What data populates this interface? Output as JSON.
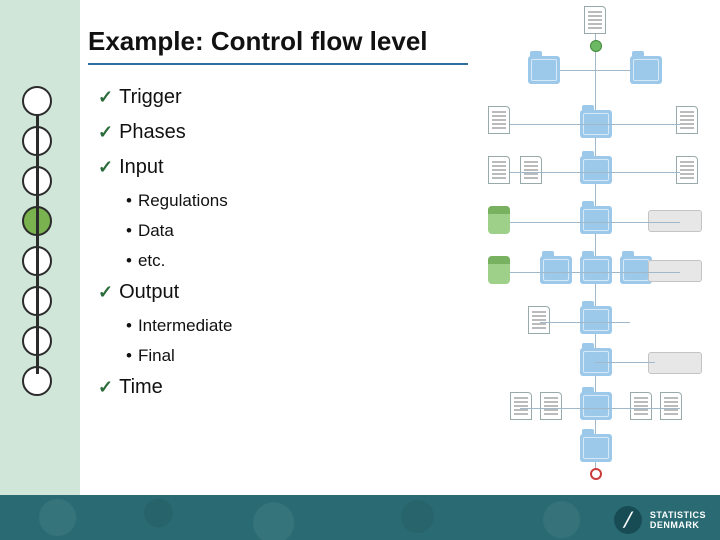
{
  "title": "Example: Control flow level",
  "bullets": {
    "trigger": "Trigger",
    "phases": "Phases",
    "input": "Input",
    "input_sub": {
      "regulations": "Regulations",
      "data": "Data",
      "etc": "etc."
    },
    "output": "Output",
    "output_sub": {
      "intermediate": "Intermediate",
      "final": "Final"
    },
    "time": "Time"
  },
  "glyph": {
    "check": "✓",
    "bullet": "•"
  },
  "footer": {
    "org_line1": "STATISTICS",
    "org_line2": "DENMARK"
  }
}
